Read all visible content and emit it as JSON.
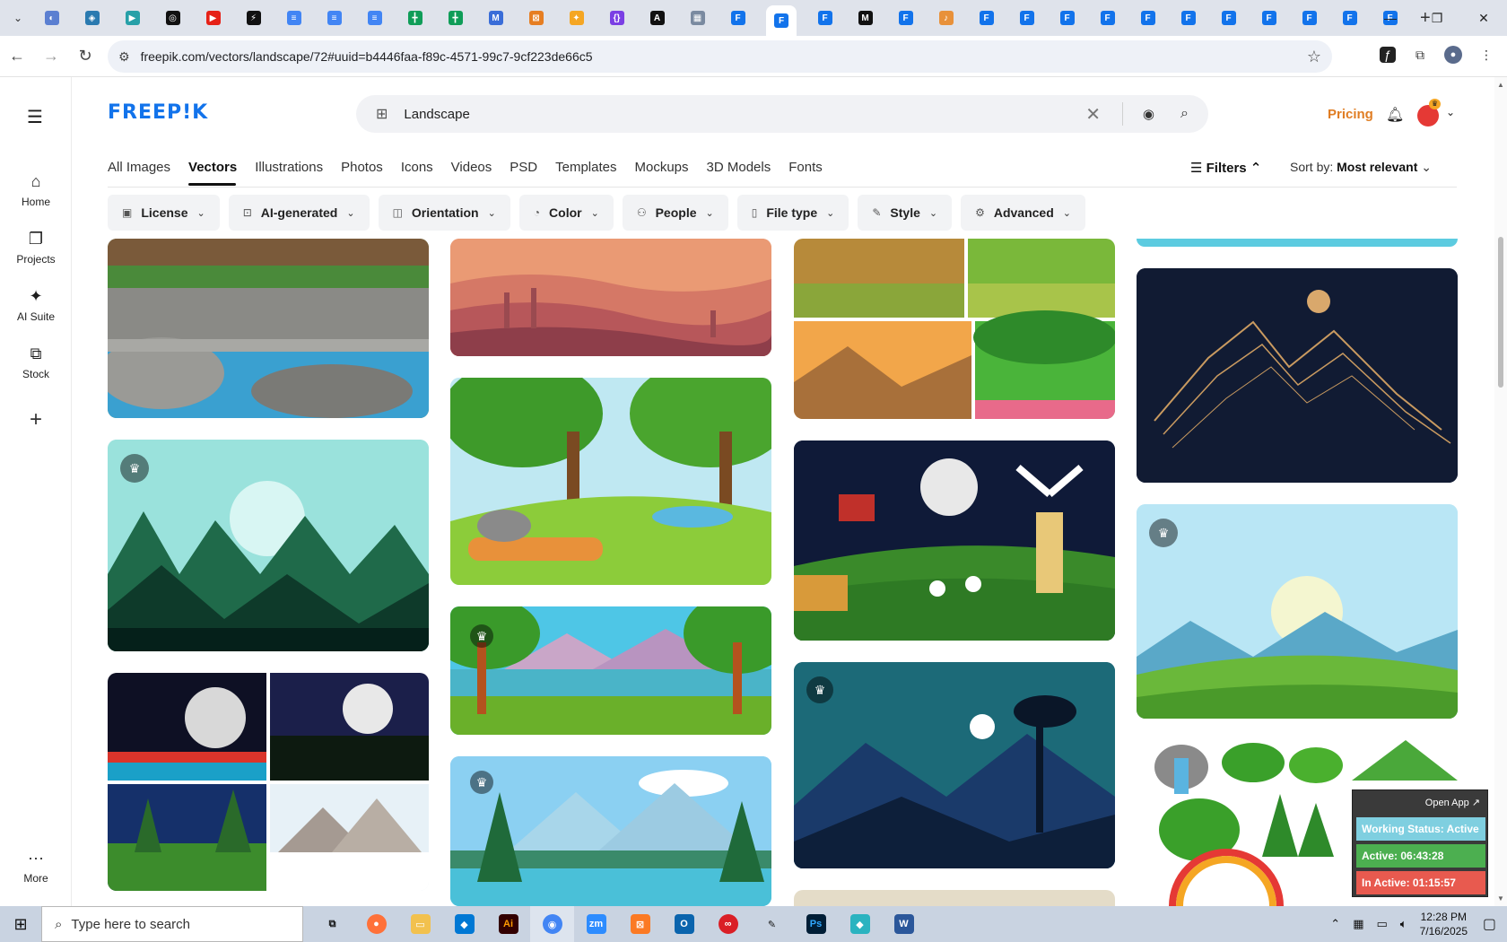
{
  "browser": {
    "url": "freepik.com/vectors/landscape/72#uuid=b4446faa-f89c-4571-99c7-9cf223de66c5",
    "tab_favicons": [
      {
        "color": "#5b7fd1",
        "glyph": "◐"
      },
      {
        "color": "#2a7ab0",
        "glyph": "◈"
      },
      {
        "color": "#27a0a8",
        "glyph": "▶"
      },
      {
        "color": "#111111",
        "glyph": "◎"
      },
      {
        "color": "#e62117",
        "glyph": "▶"
      },
      {
        "color": "#111111",
        "glyph": "⚡"
      },
      {
        "color": "#4285f4",
        "glyph": "≡"
      },
      {
        "color": "#4285f4",
        "glyph": "≡"
      },
      {
        "color": "#4285f4",
        "glyph": "≡"
      },
      {
        "color": "#0f9d58",
        "glyph": "╋"
      },
      {
        "color": "#0f9d58",
        "glyph": "╋"
      },
      {
        "color": "#3a6dd8",
        "glyph": "M"
      },
      {
        "color": "#e67e22",
        "glyph": "⊠"
      },
      {
        "color": "#f5a623",
        "glyph": "✦"
      },
      {
        "color": "#7b3fe4",
        "glyph": "{}"
      },
      {
        "color": "#111111",
        "glyph": "A"
      },
      {
        "color": "#7a8aa0",
        "glyph": "▦"
      },
      {
        "color": "#1273eb",
        "glyph": "F"
      },
      {
        "color": "#1273eb",
        "glyph": "F"
      },
      {
        "color": "#1273eb",
        "glyph": "F"
      },
      {
        "color": "#111111",
        "glyph": "M"
      },
      {
        "color": "#1273eb",
        "glyph": "F"
      },
      {
        "color": "#e8913a",
        "glyph": "♪"
      },
      {
        "color": "#1273eb",
        "glyph": "F"
      },
      {
        "color": "#1273eb",
        "glyph": "F"
      },
      {
        "color": "#1273eb",
        "glyph": "F"
      },
      {
        "color": "#1273eb",
        "glyph": "F"
      },
      {
        "color": "#1273eb",
        "glyph": "F"
      },
      {
        "color": "#1273eb",
        "glyph": "F"
      },
      {
        "color": "#1273eb",
        "glyph": "F"
      },
      {
        "color": "#1273eb",
        "glyph": "F"
      },
      {
        "color": "#1273eb",
        "glyph": "F"
      },
      {
        "color": "#1273eb",
        "glyph": "F"
      },
      {
        "color": "#1273eb",
        "glyph": "F"
      }
    ],
    "active_tab_index": 18
  },
  "sidebar": {
    "items": [
      {
        "label": "Home",
        "icon": "home-icon",
        "glyph": "⌂"
      },
      {
        "label": "Projects",
        "icon": "projects-icon",
        "glyph": "❐"
      },
      {
        "label": "AI Suite",
        "icon": "sparkle-icon",
        "glyph": "✦"
      },
      {
        "label": "Stock",
        "icon": "stock-icon",
        "glyph": "⧉"
      }
    ],
    "more_label": "More"
  },
  "header": {
    "logo": "FREEP!K",
    "search_value": "Landscape",
    "pricing": "Pricing",
    "brand_color": "#1273eb",
    "pricing_color": "#e07d23"
  },
  "categories": [
    {
      "label": "All Images",
      "active": false
    },
    {
      "label": "Vectors",
      "active": true
    },
    {
      "label": "Illustrations",
      "active": false
    },
    {
      "label": "Photos",
      "active": false
    },
    {
      "label": "Icons",
      "active": false
    },
    {
      "label": "Videos",
      "active": false
    },
    {
      "label": "PSD",
      "active": false
    },
    {
      "label": "Templates",
      "active": false
    },
    {
      "label": "Mockups",
      "active": false
    },
    {
      "label": "3D Models",
      "active": false
    },
    {
      "label": "Fonts",
      "active": false
    }
  ],
  "filters_label": "Filters",
  "sort": {
    "label": "Sort by:",
    "value": "Most relevant"
  },
  "chips": [
    {
      "label": "License",
      "icon": "license-icon"
    },
    {
      "label": "AI-generated",
      "icon": "ai-icon"
    },
    {
      "label": "Orientation",
      "icon": "orientation-icon"
    },
    {
      "label": "Color",
      "icon": "palette-icon"
    },
    {
      "label": "People",
      "icon": "people-icon"
    },
    {
      "label": "File type",
      "icon": "file-icon"
    },
    {
      "label": "Style",
      "icon": "brush-icon"
    },
    {
      "label": "Advanced",
      "icon": "gear-icon"
    }
  ],
  "status_widget": {
    "open_app": "Open App ↗",
    "working": "Working Status: Active",
    "active": "Active: 06:43:28",
    "inactive": "In Active: 01:15:57"
  },
  "taskbar": {
    "search_placeholder": "Type here to search",
    "time": "12:28 PM",
    "date": "7/16/2025"
  }
}
